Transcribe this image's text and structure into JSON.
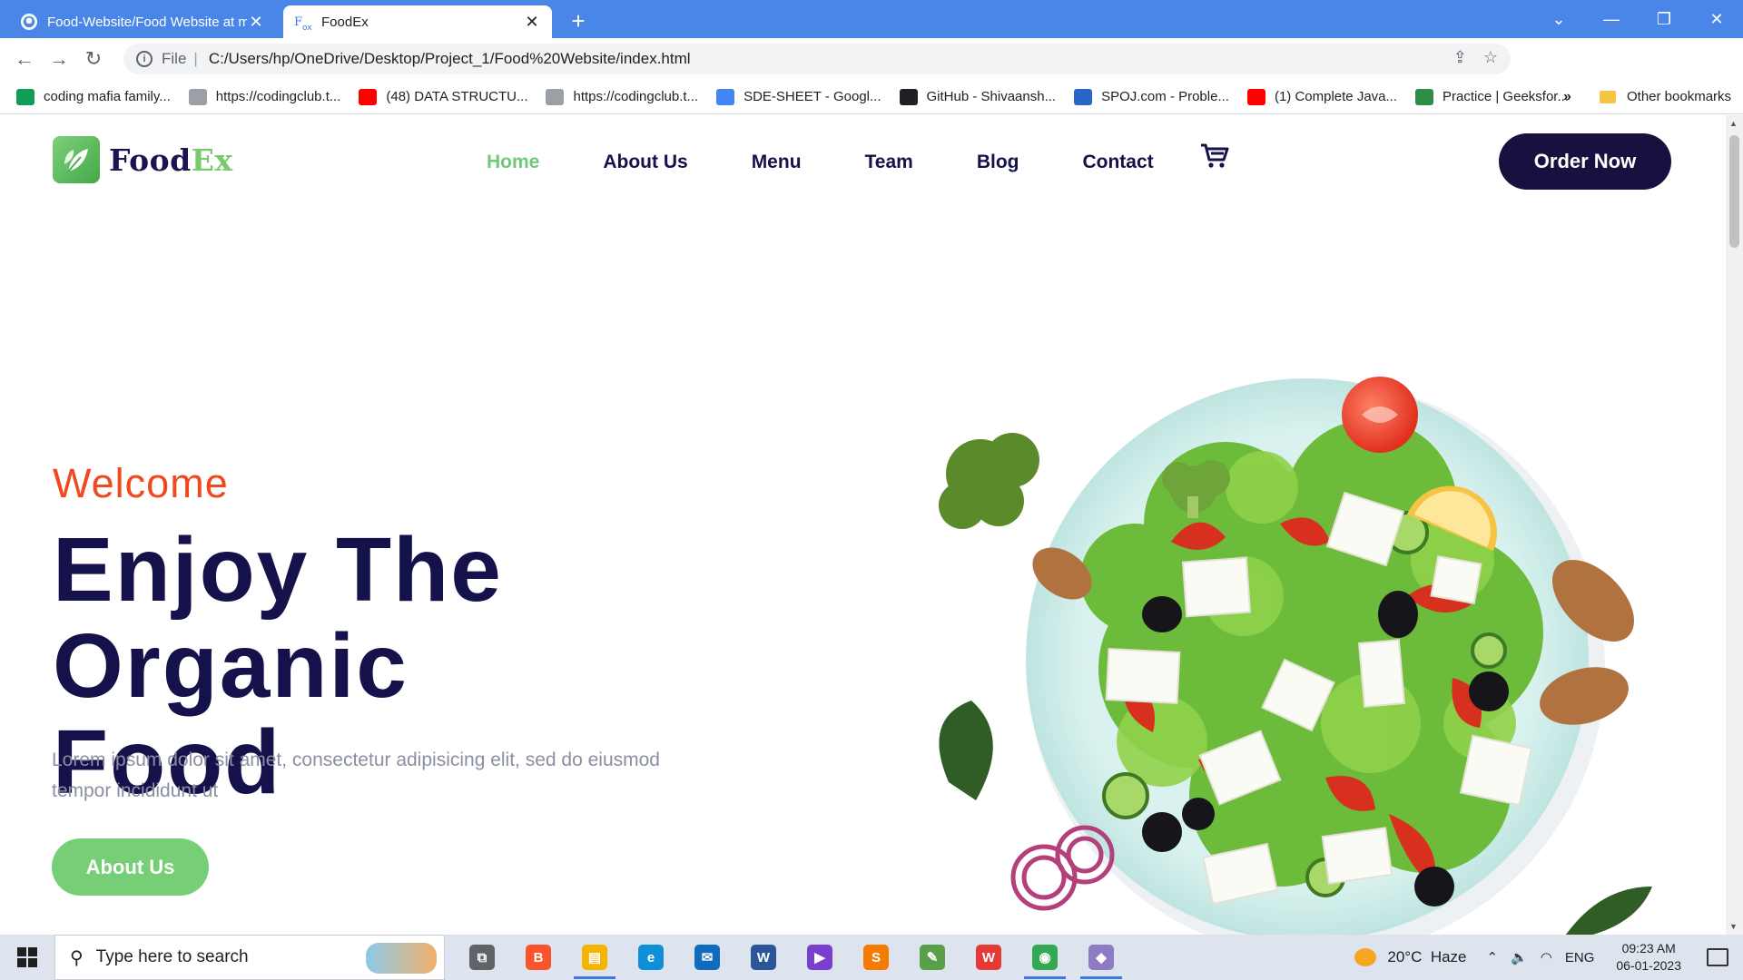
{
  "browser": {
    "tabs": [
      {
        "title": "Food-Website/Food Website at m",
        "active": false,
        "favicon": "github-icon"
      },
      {
        "title": "FoodEx",
        "active": true,
        "favicon": "foodex-icon"
      }
    ],
    "new_tab_label": "+",
    "window_controls": {
      "dropdown": "⌄",
      "minimize": "—",
      "restore": "❐",
      "close": "✕"
    },
    "address": {
      "scheme": "File",
      "url": "C:/Users/hp/OneDrive/Desktop/Project_1/Food%20Website/index.html"
    },
    "bookmarks": [
      {
        "label": "coding mafia family...",
        "icon": "sheets-icon",
        "color": "#0f9d58"
      },
      {
        "label": "https://codingclub.t...",
        "icon": "bulb-icon",
        "color": "#9aa0a6"
      },
      {
        "label": "(48) DATA STRUCTU...",
        "icon": "youtube-icon",
        "color": "#ff0000"
      },
      {
        "label": "https://codingclub.t...",
        "icon": "bulb-icon",
        "color": "#9aa0a6"
      },
      {
        "label": "SDE-SHEET - Googl...",
        "icon": "docs-icon",
        "color": "#4285f4"
      },
      {
        "label": "GitHub - Shivaansh...",
        "icon": "github-icon",
        "color": "#202124"
      },
      {
        "label": "SPOJ.com - Proble...",
        "icon": "spoj-icon",
        "color": "#2a66c7"
      },
      {
        "label": "(1) Complete Java...",
        "icon": "youtube-icon",
        "color": "#ff0000"
      },
      {
        "label": "Practice | Geeksfor...",
        "icon": "gfg-icon",
        "color": "#2f8d46"
      }
    ],
    "bookmarks_more": "»",
    "other_bookmarks": "Other bookmarks"
  },
  "site": {
    "logo": {
      "part1": "Food",
      "part2": "Ex"
    },
    "nav": [
      {
        "label": "Home",
        "active": true
      },
      {
        "label": "About Us",
        "active": false
      },
      {
        "label": "Menu",
        "active": false
      },
      {
        "label": "Team",
        "active": false
      },
      {
        "label": "Blog",
        "active": false
      },
      {
        "label": "Contact",
        "active": false
      }
    ],
    "order_button": "Order Now",
    "hero": {
      "welcome": "Welcome",
      "title_line1": "Enjoy The Organic",
      "title_line2": "Food",
      "text": "Lorem ipsum dolor sit amet, consectetur adipisicing elit, sed do eiusmod tempor incididunt ut",
      "button": "About Us"
    },
    "colors": {
      "primary": "#15114a",
      "accent_green": "#76cf77",
      "accent_orange": "#f0491f"
    }
  },
  "taskbar": {
    "search_placeholder": "Type here to search",
    "apps": [
      {
        "name": "task-view-icon",
        "label": "⧉",
        "color": "#5f6368",
        "running": false
      },
      {
        "name": "brave-icon",
        "label": "B",
        "color": "#fb542b",
        "running": false
      },
      {
        "name": "file-explorer-icon",
        "label": "▤",
        "color": "#f4b400",
        "running": true
      },
      {
        "name": "edge-icon",
        "label": "e",
        "color": "#0f8fd8",
        "running": false
      },
      {
        "name": "mail-icon",
        "label": "✉",
        "color": "#0f6cbd",
        "running": false
      },
      {
        "name": "word-icon",
        "label": "W",
        "color": "#2b579a",
        "running": false
      },
      {
        "name": "vs-icon",
        "label": "▶",
        "color": "#7b3fd0",
        "running": false
      },
      {
        "name": "sublime-icon",
        "label": "S",
        "color": "#f57c00",
        "running": false
      },
      {
        "name": "paint-icon",
        "label": "✎",
        "color": "#5aa048",
        "running": false
      },
      {
        "name": "wps-icon",
        "label": "W",
        "color": "#e53935",
        "running": false
      },
      {
        "name": "chrome-icon",
        "label": "◉",
        "color": "#34a853",
        "running": true
      },
      {
        "name": "app-icon",
        "label": "◆",
        "color": "#8e7cc3",
        "running": true
      }
    ],
    "weather": {
      "temp": "20°C",
      "condition": "Haze"
    },
    "language": "ENG",
    "time": "09:23 AM",
    "date": "06-01-2023"
  }
}
